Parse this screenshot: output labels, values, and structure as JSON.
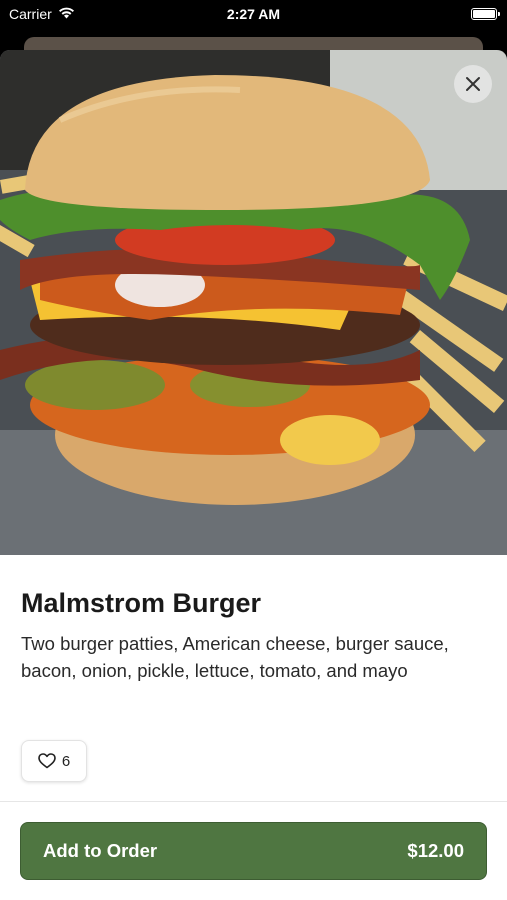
{
  "status_bar": {
    "carrier": "Carrier",
    "time": "2:27 AM",
    "icons": [
      "wifi-icon",
      "battery-icon"
    ]
  },
  "item": {
    "image_icon": "burger-photo",
    "title": "Malmstrom Burger",
    "description": "Two burger patties, American cheese, burger sauce, bacon, onion, pickle, lettuce, tomato, and mayo",
    "likes": "6",
    "like_icon": "heart-icon"
  },
  "actions": {
    "close_icon": "close-icon",
    "add_label": "Add to Order",
    "price": "$12.00"
  },
  "colors": {
    "accent": "#4f7641",
    "text": "#1a1a1a"
  }
}
